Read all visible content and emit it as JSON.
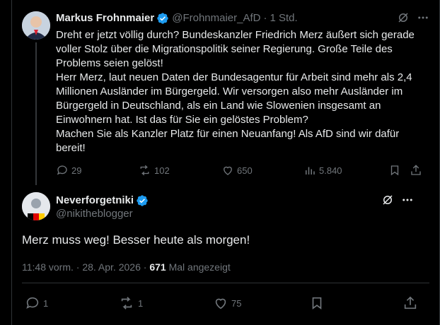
{
  "tweet": {
    "author_name": "Markus Frohnmaier",
    "handle": "@Frohnmaier_AfD",
    "separator": "·",
    "time": "1 Std.",
    "text_lines": [
      "Dreht er jetzt völlig durch? Bundeskanzler Friedrich Merz äußert sich gerade",
      "voller Stolz über die Migrationspolitik seiner Regierung. Große Teile des",
      "Problems seien gelöst!",
      "Herr Merz, laut neuen Daten der Bundesagentur für Arbeit sind mehr als 2,4",
      "Millionen Ausländer im Bürgergeld. Wir versorgen also mehr Ausländer im",
      "Bürgergeld in Deutschland, als ein Land wie Slowenien insgesamt an",
      "Einwohnern hat. Ist das für Sie ein gelöstes Problem?",
      "Machen Sie als Kanzler Platz für einen Neuanfang! Als AfD sind wir dafür",
      "bereit!"
    ],
    "stats": {
      "replies": "29",
      "reposts": "102",
      "likes": "650",
      "views": "5.840"
    }
  },
  "reply": {
    "author_name": "Neverforgetniki",
    "handle": "@nikitheblogger",
    "text": "Merz muss weg! Besser heute als morgen!",
    "time": "11:48 vorm.",
    "separator": "·",
    "date": "28. Apr. 2026",
    "separator2": "·",
    "views_count": "671",
    "views_label": "Mal angezeigt",
    "stats": {
      "replies": "1",
      "reposts": "1",
      "likes": "75"
    }
  },
  "colors": {
    "background": "#000000",
    "text": "#e7e9ea",
    "muted": "#71767b",
    "verified": "#1d9bf0",
    "border": "#2f3336"
  },
  "icons": [
    "verified-badge-icon",
    "grok-icon",
    "more-icon",
    "reply-icon",
    "repost-icon",
    "like-icon",
    "views-icon",
    "bookmark-icon",
    "share-icon"
  ]
}
